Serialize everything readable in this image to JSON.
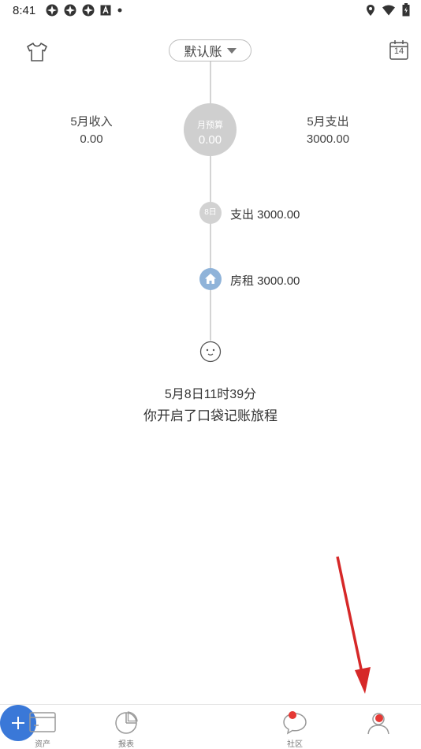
{
  "status_bar": {
    "time": "8:41",
    "left_icons": [
      "app-notification-icon",
      "app-notification-icon",
      "app-notification-icon",
      "a-badge-icon",
      "dot-icon"
    ],
    "right_icons": [
      "location-icon",
      "wifi-icon",
      "battery-icon"
    ]
  },
  "header": {
    "book_selector": "默认账",
    "calendar_day": "14"
  },
  "summary": {
    "income_label": "5月收入",
    "income_value": "0.00",
    "budget_label": "月预算",
    "budget_value": "0.00",
    "expense_label": "5月支出",
    "expense_value": "3000.00"
  },
  "timeline": {
    "day_badge": "8日",
    "day_summary": "支出 3000.00",
    "entry": "房租 3000.00",
    "start_date": "5月8日11时39分",
    "start_message": "你开启了口袋记账旅程"
  },
  "nav": {
    "assets": "资产",
    "reports": "报表",
    "community": "社区"
  },
  "colors": {
    "accent": "#3a78d8",
    "budget_circle": "#cfcfcf",
    "category_icon": "#8fb3d9",
    "annotation_arrow": "#d62828"
  }
}
